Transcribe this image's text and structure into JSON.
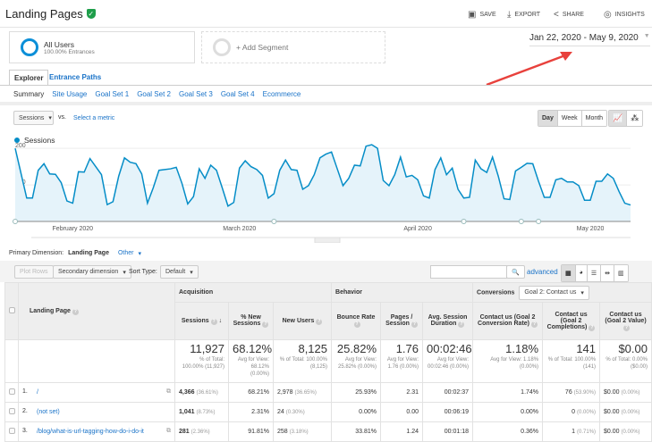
{
  "header": {
    "title": "Landing Pages",
    "save": "Save",
    "export": "Export",
    "share": "Share",
    "insights": "Insights"
  },
  "segments": {
    "all_users": "All Users",
    "all_users_sub": "100.00% Entrances",
    "add": "+ Add Segment"
  },
  "date_range": "Jan 22, 2020 - May 9, 2020",
  "tabs": [
    "Explorer",
    "Entrance Paths"
  ],
  "subnav": [
    "Summary",
    "Site Usage",
    "Goal Set 1",
    "Goal Set 2",
    "Goal Set 3",
    "Goal Set 4",
    "Ecommerce"
  ],
  "chart_controls": {
    "metric": "Sessions",
    "vs": "vs.",
    "select_metric": "Select a metric",
    "periods": [
      "Day",
      "Week",
      "Month"
    ],
    "active_period": "Day"
  },
  "colors": {
    "series": "#058dc7",
    "fill": "#e5f3fa",
    "link": "#1a73c8",
    "arrow": "#e8413c"
  },
  "chart_data": {
    "type": "area",
    "series": [
      {
        "name": "Sessions",
        "values": [
          200,
          132,
          64,
          64,
          140,
          158,
          130,
          129,
          106,
          56,
          50,
          136,
          135,
          172,
          150,
          128,
          46,
          54,
          124,
          174,
          162,
          158,
          130,
          50,
          92,
          140,
          142,
          144,
          148,
          104,
          48,
          68,
          144,
          118,
          154,
          140,
          92,
          42,
          52,
          146,
          166,
          150,
          142,
          126,
          64,
          76,
          140,
          168,
          142,
          140,
          88,
          98,
          128,
          174,
          184,
          190,
          144,
          98,
          118,
          154,
          152,
          206,
          210,
          200,
          112,
          98,
          128,
          176,
          122,
          126,
          114,
          70,
          64,
          142,
          174,
          128,
          146,
          88,
          64,
          66,
          168,
          144,
          134,
          176,
          124,
          62,
          60,
          138,
          148,
          159,
          158,
          110,
          66,
          66,
          114,
          118,
          108,
          108,
          98,
          58,
          58,
          110,
          110,
          130,
          118,
          82,
          50,
          45
        ]
      }
    ],
    "x_start": "Jan 22, 2020",
    "x_end": "May 9, 2020",
    "y_ticks": [
      100,
      200
    ],
    "x_ticks": [
      "February 2020",
      "March 2020",
      "April 2020",
      "May 2020"
    ],
    "ylim": [
      0,
      215
    ],
    "grid": true,
    "legend": "top-left"
  },
  "dimension": {
    "label": "Primary Dimension:",
    "value": "Landing Page",
    "other": "Other"
  },
  "toolbar": {
    "plot_rows": "Plot Rows",
    "secondary": "Secondary dimension",
    "sort_label": "Sort Type:",
    "sort_value": "Default",
    "advanced": "advanced"
  },
  "table": {
    "groups": {
      "acquisition": "Acquisition",
      "behavior": "Behavior",
      "conversions": "Conversions",
      "goal_select": "Goal 2: Contact us"
    },
    "columns": [
      "Landing Page",
      "Sessions",
      "% New Sessions",
      "New Users",
      "Bounce Rate",
      "Pages / Session",
      "Avg. Session Duration",
      "Contact us (Goal 2 Conversion Rate)",
      "Contact us (Goal 2 Completions)",
      "Contact us (Goal 2 Value)"
    ],
    "totals": [
      {
        "v": "11,927",
        "s": "% of Total: 100.00% (11,927)"
      },
      {
        "v": "68.12%",
        "s": "Avg for View: 68.12% (0.00%)"
      },
      {
        "v": "8,125",
        "s": "% of Total: 100.00% (8,125)"
      },
      {
        "v": "25.82%",
        "s": "Avg for View: 25.82% (0.00%)"
      },
      {
        "v": "1.76",
        "s": "Avg for View: 1.76 (0.00%)"
      },
      {
        "v": "00:02:46",
        "s": "Avg for View: 00:02:46 (0.00%)"
      },
      {
        "v": "1.18%",
        "s": "Avg for View: 1.18% (0.00%)"
      },
      {
        "v": "141",
        "s": "% of Total: 100.00% (141)"
      },
      {
        "v": "$0.00",
        "s": "% of Total: 0.00% ($0.00)"
      }
    ],
    "rows": [
      {
        "n": "1.",
        "page": "/",
        "sessions": "4,366",
        "sessions_pct": "(36.61%)",
        "new_sess": "68.21%",
        "new_users": "2,978",
        "new_users_pct": "(36.65%)",
        "bounce": "25.93%",
        "pages": "2.31",
        "dur": "00:02:37",
        "conv": "1.74%",
        "comp": "76",
        "comp_pct": "(53.90%)",
        "val": "$0.00",
        "val_pct": "(0.00%)"
      },
      {
        "n": "2.",
        "page": "(not set)",
        "sessions": "1,041",
        "sessions_pct": "(8.73%)",
        "new_sess": "2.31%",
        "new_users": "24",
        "new_users_pct": "(0.30%)",
        "bounce": "0.00%",
        "pages": "0.00",
        "dur": "00:06:19",
        "conv": "0.00%",
        "comp": "0",
        "comp_pct": "(0.00%)",
        "val": "$0.00",
        "val_pct": "(0.00%)"
      },
      {
        "n": "3.",
        "page": "/blog/what-is-url-tagging-how-do-i-do-it",
        "sessions": "281",
        "sessions_pct": "(2.36%)",
        "new_sess": "91.81%",
        "new_users": "258",
        "new_users_pct": "(3.18%)",
        "bounce": "33.81%",
        "pages": "1.24",
        "dur": "00:01:18",
        "conv": "0.36%",
        "comp": "1",
        "comp_pct": "(0.71%)",
        "val": "$0.00",
        "val_pct": "(0.00%)"
      }
    ]
  }
}
